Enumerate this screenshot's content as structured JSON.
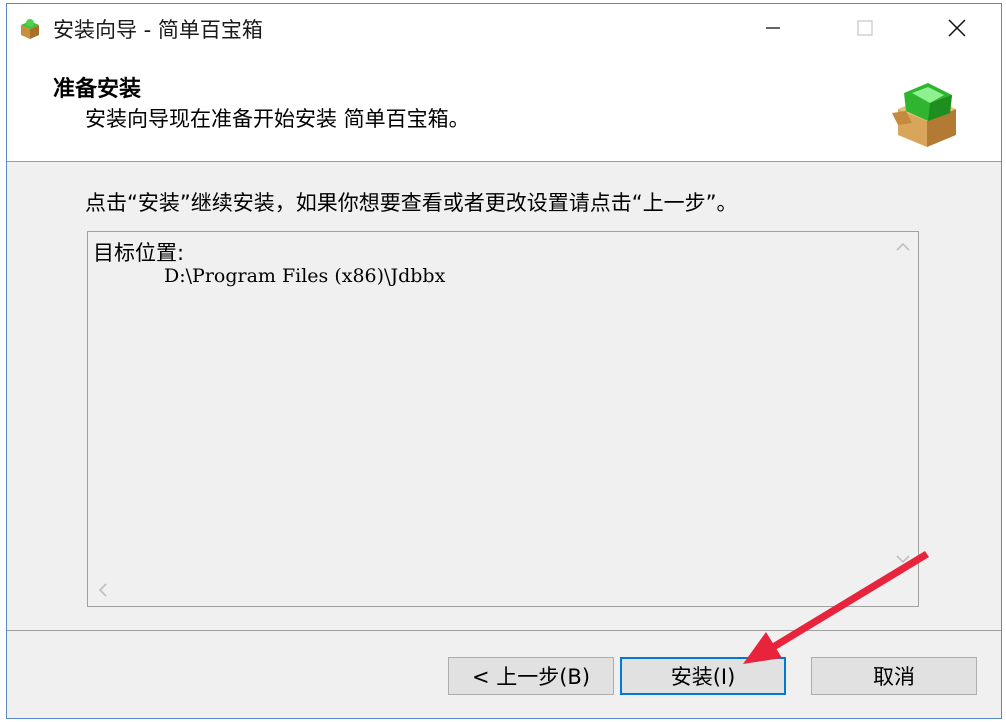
{
  "window": {
    "title": "安装向导 - 简单百宝箱",
    "app_icon": "installer-box-icon",
    "controls": [
      "minimize-icon",
      "maximize-icon",
      "close-icon"
    ]
  },
  "header": {
    "title": "准备安装",
    "subtitle": "安装向导现在准备开始安装 简单百宝箱。",
    "icon": "package-box-icon"
  },
  "instruction": "点击“安装”继续安装，如果你想要查看或者更改设置请点击“上一步”。",
  "memo": {
    "heading": "目标位置:",
    "path": "D:\\Program Files (x86)\\Jdbbx"
  },
  "buttons": {
    "back": "< 上一步(B)",
    "install": "安装(I)",
    "cancel": "取消"
  },
  "colors": {
    "accent": "#0078d7",
    "annotation_arrow": "#e8233c",
    "window_border": "#5a87c5"
  }
}
